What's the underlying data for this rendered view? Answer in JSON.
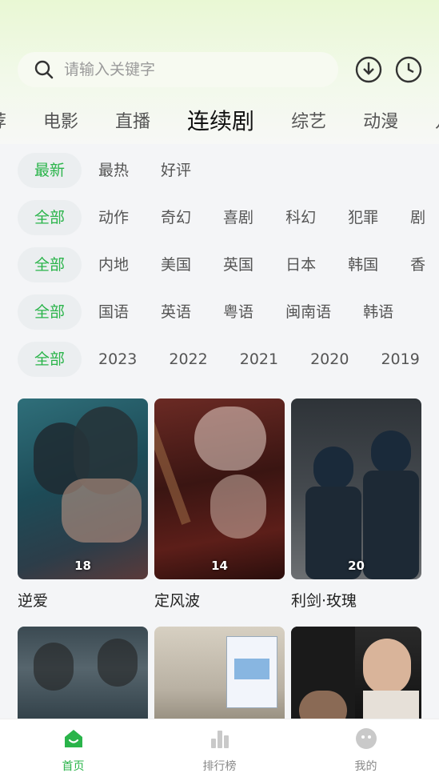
{
  "search": {
    "placeholder": "请输入关键字"
  },
  "icons": {
    "search": "search-icon",
    "download": "download-icon",
    "history": "clock-icon"
  },
  "categories": [
    {
      "label": "荐",
      "active": false
    },
    {
      "label": "电影",
      "active": false
    },
    {
      "label": "直播",
      "active": false
    },
    {
      "label": "连续剧",
      "active": true
    },
    {
      "label": "综艺",
      "active": false
    },
    {
      "label": "动漫",
      "active": false
    },
    {
      "label": "儿",
      "active": false
    }
  ],
  "filters": {
    "sort": [
      "最新",
      "最热",
      "好评"
    ],
    "genre": [
      "全部",
      "动作",
      "奇幻",
      "喜剧",
      "科幻",
      "犯罪",
      "剧"
    ],
    "region": [
      "全部",
      "内地",
      "美国",
      "英国",
      "日本",
      "韩国",
      "香"
    ],
    "language": [
      "全部",
      "国语",
      "英语",
      "粤语",
      "闽南语",
      "韩语"
    ],
    "year": [
      "全部",
      "2023",
      "2022",
      "2021",
      "2020",
      "2019"
    ]
  },
  "videos": [
    {
      "title": "逆爱",
      "badge": "18"
    },
    {
      "title": "定风波",
      "badge": "14"
    },
    {
      "title": "利剑·玫瑰",
      "badge": "20"
    },
    {
      "title": "",
      "badge": ""
    },
    {
      "title": "",
      "badge": ""
    },
    {
      "title": "",
      "badge": ""
    }
  ],
  "bottom_nav": [
    {
      "label": "首页",
      "active": true
    },
    {
      "label": "排行榜",
      "active": false
    },
    {
      "label": "我的",
      "active": false
    }
  ],
  "colors": {
    "accent": "#2ab44a",
    "top_gradient": "#e9f8d4",
    "background": "#f4f5f7"
  }
}
